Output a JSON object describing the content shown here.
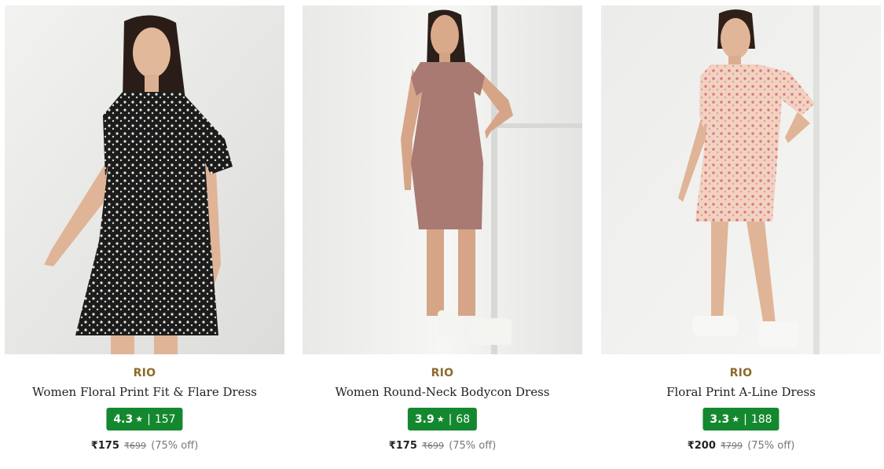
{
  "colors": {
    "accent_brand": "#8b6a2b",
    "rating_bg": "#14882f"
  },
  "products": [
    {
      "image": "model-in-black-floral-dress",
      "brand": "RIO",
      "title": "Women Floral Print Fit & Flare Dress",
      "rating": "4.3",
      "star": "★",
      "sep": "|",
      "reviews": "157",
      "price": "₹175",
      "mrp": "₹699",
      "discount": "(75% off)"
    },
    {
      "image": "model-in-mauve-bodycon-dress",
      "brand": "RIO",
      "title": "Women Round-Neck Bodycon Dress",
      "rating": "3.9",
      "star": "★",
      "sep": "|",
      "reviews": "68",
      "price": "₹175",
      "mrp": "₹699",
      "discount": "(75% off)"
    },
    {
      "image": "model-in-peach-floral-aline-dress",
      "brand": "RIO",
      "title": "Floral Print A-Line Dress",
      "rating": "3.3",
      "star": "★",
      "sep": "|",
      "reviews": "188",
      "price": "₹200",
      "mrp": "₹799",
      "discount": "(75% off)"
    }
  ]
}
